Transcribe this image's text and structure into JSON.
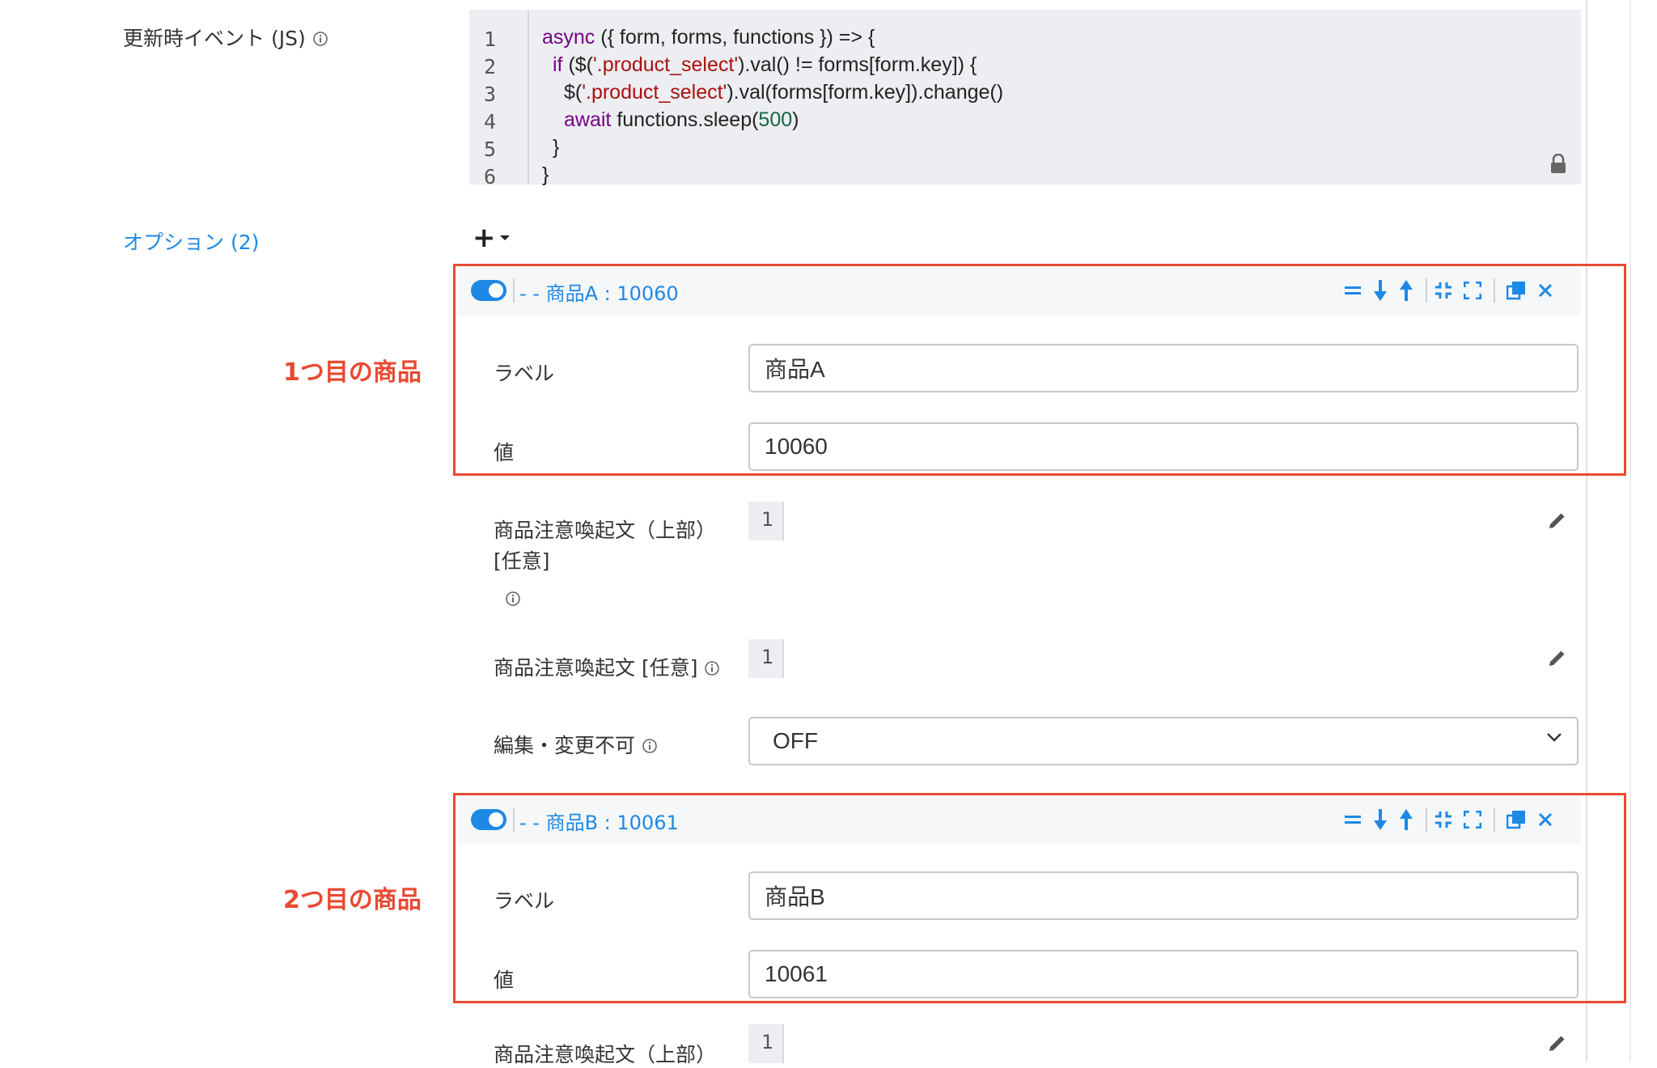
{
  "js_event": {
    "label": "更新時イベント (JS)",
    "line_numbers": [
      "1",
      "2",
      "3",
      "4",
      "5",
      "6"
    ]
  },
  "options": {
    "title": "オプション (2)",
    "add_icon": "plus-dropdown-icon"
  },
  "annotations": {
    "first": "1つ目の商品",
    "second": "2つ目の商品"
  },
  "items": [
    {
      "header": "- - 商品A : 10060",
      "label_caption": "ラベル",
      "label_value": "商品A",
      "value_caption": "値",
      "value_value": "10060",
      "notice_top_line1": "商品注意喚起文（上部）",
      "notice_top_line2": "[任意]",
      "editor_line": "1",
      "notice_caption": "商品注意喚起文 [任意]",
      "lock_caption": "編集・変更不可",
      "lock_value": "OFF"
    },
    {
      "header": "- - 商品B : 10061",
      "label_caption": "ラベル",
      "label_value": "商品B",
      "value_caption": "値",
      "value_value": "10061",
      "notice_top_line1": "商品注意喚起文（上部）",
      "editor_line": "1"
    }
  ],
  "colors": {
    "accent": "#1e88e5",
    "annotation": "#e84a32",
    "editor_bg": "#eceef1"
  }
}
